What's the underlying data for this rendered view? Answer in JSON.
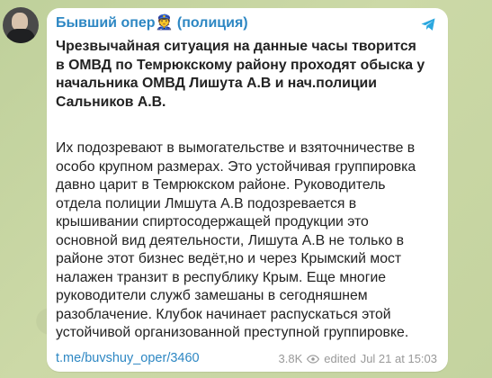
{
  "post": {
    "sender": "Бывший опер👮 (полиция)",
    "headline": "Чрезвычайная ситуация на данные часы творится в ОМВД по Темрюкскому району проходят обыска у начальника ОМВД Лишута А.В и нач.полиции Сальников А.В.",
    "body": "Их подозревают в вымогательстве и взяточничестве в особо крупном размерах. Это устойчивая группировка давно царит в Темрюкском районе. Руководитель отдела полиции Лмшута А.В подозревается в крышивании спиртосодержащей продукции это основной вид деятельности, Лишута А.В не только в районе этот бизнес ведёт,но и через Крымский мост налажен транзит в республику Крым. Еще многие руководители служб замешаны в сегодняшнем разоблачение. Клубок начинает распускаться этой устойчивой организованной преступной группировке.",
    "link": "t.me/buvshuy_oper/3460",
    "views": "3.8K",
    "edited_label": "edited",
    "timestamp": "Jul 21 at 15:03"
  },
  "icons": {
    "share": "share-icon",
    "views": "eye-icon",
    "avatar": "avatar"
  },
  "colors": {
    "background": "#c8d5a3",
    "bubble": "#ffffff",
    "sender": "#2d87c3",
    "link": "#2d87c3",
    "meta": "#999999"
  }
}
